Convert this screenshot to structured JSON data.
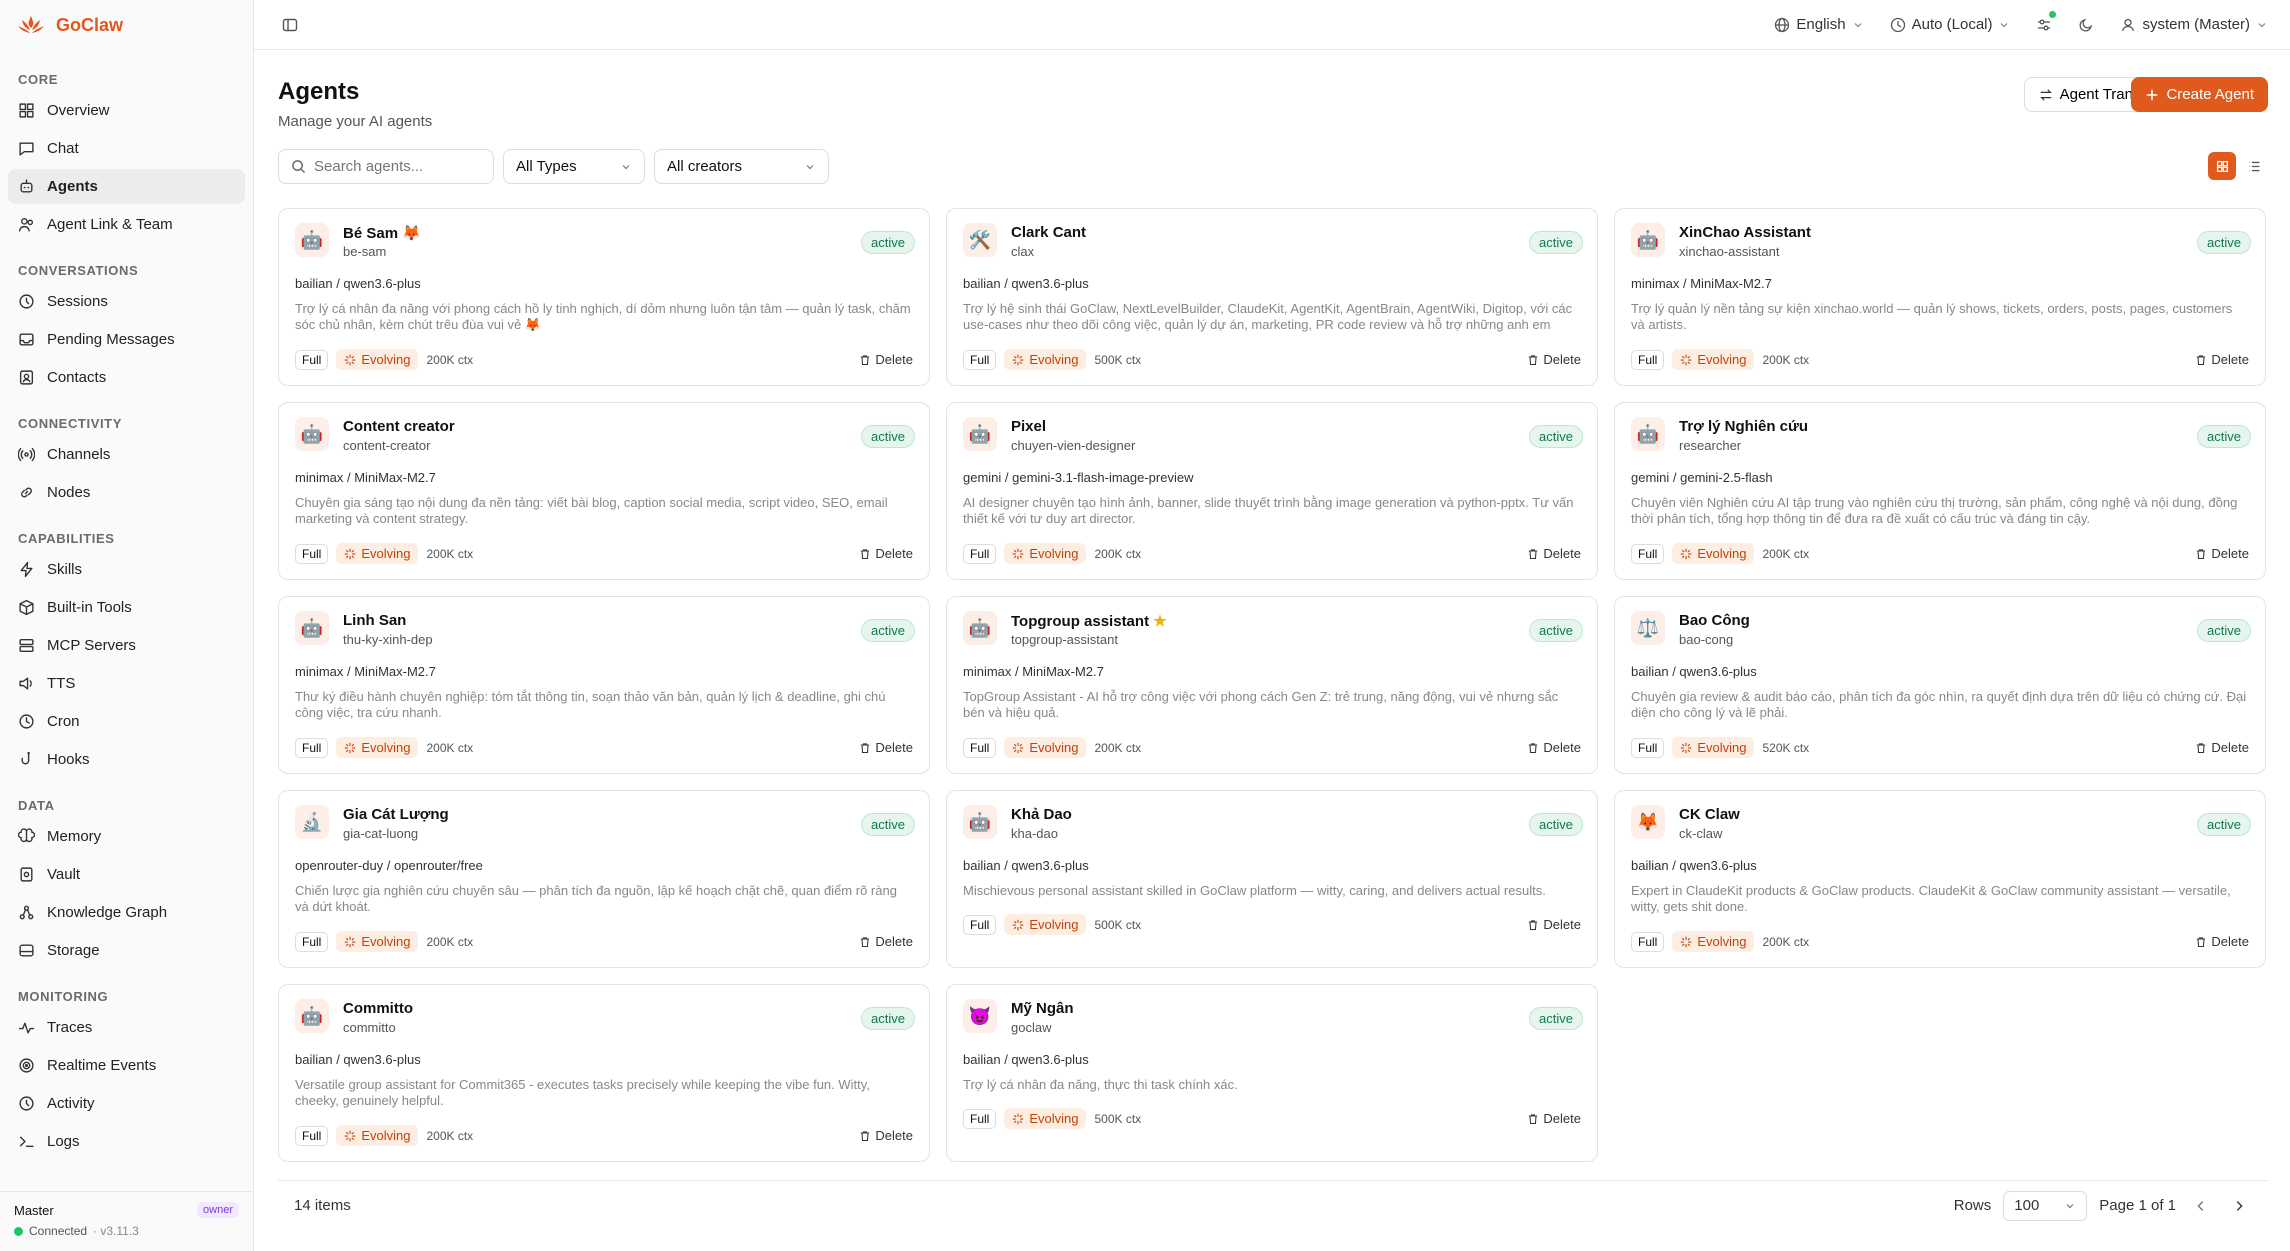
{
  "app": {
    "name": "GoClaw"
  },
  "topbar": {
    "language": "English",
    "timezone": "Auto (Local)",
    "user": "system (Master)"
  },
  "sidebar": {
    "sections": [
      {
        "title": "CORE",
        "items": [
          {
            "label": "Overview",
            "icon": "grid-icon"
          },
          {
            "label": "Chat",
            "icon": "chat-icon"
          },
          {
            "label": "Agents",
            "icon": "bot-icon",
            "active": true
          },
          {
            "label": "Agent Link & Team",
            "icon": "users-icon"
          }
        ]
      },
      {
        "title": "CONVERSATIONS",
        "items": [
          {
            "label": "Sessions",
            "icon": "history-icon"
          },
          {
            "label": "Pending Messages",
            "icon": "inbox-icon"
          },
          {
            "label": "Contacts",
            "icon": "contacts-icon"
          }
        ]
      },
      {
        "title": "CONNECTIVITY",
        "items": [
          {
            "label": "Channels",
            "icon": "radio-icon"
          },
          {
            "label": "Nodes",
            "icon": "link-icon"
          }
        ]
      },
      {
        "title": "CAPABILITIES",
        "items": [
          {
            "label": "Skills",
            "icon": "zap-icon"
          },
          {
            "label": "Built-in Tools",
            "icon": "package-icon"
          },
          {
            "label": "MCP Servers",
            "icon": "server-icon"
          },
          {
            "label": "TTS",
            "icon": "volume-icon"
          },
          {
            "label": "Cron",
            "icon": "clock-icon"
          },
          {
            "label": "Hooks",
            "icon": "hook-icon"
          }
        ]
      },
      {
        "title": "DATA",
        "items": [
          {
            "label": "Memory",
            "icon": "brain-icon"
          },
          {
            "label": "Vault",
            "icon": "vault-icon"
          },
          {
            "label": "Knowledge Graph",
            "icon": "graph-icon"
          },
          {
            "label": "Storage",
            "icon": "storage-icon"
          }
        ]
      },
      {
        "title": "MONITORING",
        "items": [
          {
            "label": "Traces",
            "icon": "activity-icon"
          },
          {
            "label": "Realtime Events",
            "icon": "radar-icon"
          },
          {
            "label": "Activity",
            "icon": "history-icon"
          },
          {
            "label": "Logs",
            "icon": "terminal-icon"
          }
        ]
      }
    ],
    "footer": {
      "user": "Master",
      "role": "owner",
      "status": "Connected",
      "version": "· v3.11.3"
    }
  },
  "page": {
    "title": "Agents",
    "subtitle": "Manage your AI agents",
    "transfer_label": "Agent Transfer",
    "create_label": "Create Agent"
  },
  "filters": {
    "search_placeholder": "Search agents...",
    "types": "All Types",
    "creators": "All creators"
  },
  "agents": [
    {
      "name": "Bé Sam 🦊",
      "key": "be-sam",
      "status": "active",
      "model": "bailian / qwen3.6-plus",
      "desc": "Trợ lý cá nhân đa năng với phong cách hồ ly tinh nghịch, dí dỏm nhưng luôn tận tâm — quản lý task, chăm sóc chủ nhân, kèm chút trêu đùa vui vẻ 🦊",
      "access": "Full",
      "evolving": "Evolving",
      "ctx": "200K ctx",
      "delete": "Delete",
      "avatar": "🤖"
    },
    {
      "name": "Clark Cant",
      "key": "clax",
      "status": "active",
      "model": "bailian / qwen3.6-plus",
      "desc": "Trợ lý hệ sinh thái GoClaw, NextLevelBuilder, ClaudeKit, AgentKit, AgentBrain, AgentWiki, Digitop, với các use-cases như theo dõi công việc, quản lý dự án, marketing, PR code review và hỗ trợ những anh em khác.",
      "access": "Full",
      "evolving": "Evolving",
      "ctx": "500K ctx",
      "delete": "Delete",
      "avatar": "🛠️"
    },
    {
      "name": "XinChao Assistant",
      "key": "xinchao-assistant",
      "status": "active",
      "model": "minimax / MiniMax-M2.7",
      "desc": "Trợ lý quản lý nền tảng sự kiện xinchao.world — quản lý shows, tickets, orders, posts, pages, customers và artists.",
      "access": "Full",
      "evolving": "Evolving",
      "ctx": "200K ctx",
      "delete": "Delete",
      "avatar": "🤖"
    },
    {
      "name": "Content creator",
      "key": "content-creator",
      "status": "active",
      "model": "minimax / MiniMax-M2.7",
      "desc": "Chuyên gia sáng tạo nội dung đa nền tảng: viết bài blog, caption social media, script video, SEO, email marketing và content strategy.",
      "access": "Full",
      "evolving": "Evolving",
      "ctx": "200K ctx",
      "delete": "Delete",
      "avatar": "🤖"
    },
    {
      "name": "Pixel",
      "key": "chuyen-vien-designer",
      "status": "active",
      "model": "gemini / gemini-3.1-flash-image-preview",
      "desc": "AI designer chuyên tạo hình ảnh, banner, slide thuyết trình bằng image generation và python-pptx. Tư vấn thiết kế với tư duy art director.",
      "access": "Full",
      "evolving": "Evolving",
      "ctx": "200K ctx",
      "delete": "Delete",
      "avatar": "🤖"
    },
    {
      "name": "Trợ lý Nghiên cứu",
      "key": "researcher",
      "status": "active",
      "model": "gemini / gemini-2.5-flash",
      "desc": "Chuyên viên Nghiên cứu AI tập trung vào nghiên cứu thị trường, sản phẩm, công nghệ và nội dung, đồng thời phân tích, tổng hợp thông tin để đưa ra đề xuất có cấu trúc và đáng tin cậy.",
      "access": "Full",
      "evolving": "Evolving",
      "ctx": "200K ctx",
      "delete": "Delete",
      "avatar": "🤖"
    },
    {
      "name": "Linh San",
      "key": "thu-ky-xinh-dep",
      "status": "active",
      "model": "minimax / MiniMax-M2.7",
      "desc": "Thư ký điều hành chuyên nghiệp: tóm tắt thông tin, soạn thảo văn bản, quản lý lịch & deadline, ghi chú công việc, tra cứu nhanh.",
      "access": "Full",
      "evolving": "Evolving",
      "ctx": "200K ctx",
      "delete": "Delete",
      "avatar": "🤖"
    },
    {
      "name": "Topgroup assistant",
      "key": "topgroup-assistant",
      "status": "active",
      "model": "minimax / MiniMax-M2.7",
      "desc": "TopGroup Assistant - AI hỗ trợ công việc với phong cách Gen Z: trẻ trung, năng động, vui vẻ nhưng sắc bén và hiệu quả.",
      "access": "Full",
      "evolving": "Evolving",
      "ctx": "200K ctx",
      "delete": "Delete",
      "avatar": "🤖",
      "star": true
    },
    {
      "name": "Bao Công",
      "key": "bao-cong",
      "status": "active",
      "model": "bailian / qwen3.6-plus",
      "desc": "Chuyên gia review & audit báo cáo, phân tích đa góc nhìn, ra quyết định dựa trên dữ liệu có chứng cứ. Đại diện cho công lý và lẽ phải.",
      "access": "Full",
      "evolving": "Evolving",
      "ctx": "520K ctx",
      "delete": "Delete",
      "avatar": "⚖️"
    },
    {
      "name": "Gia Cát Lượng",
      "key": "gia-cat-luong",
      "status": "active",
      "model": "openrouter-duy / openrouter/free",
      "desc": "Chiến lược gia nghiên cứu chuyên sâu — phân tích đa nguồn, lập kế hoạch chặt chẽ, quan điểm rõ ràng và dứt khoát.",
      "access": "Full",
      "evolving": "Evolving",
      "ctx": "200K ctx",
      "delete": "Delete",
      "avatar": "🔬"
    },
    {
      "name": "Khả Dao",
      "key": "kha-dao",
      "status": "active",
      "model": "bailian / qwen3.6-plus",
      "desc": "Mischievous personal assistant skilled in GoClaw platform — witty, caring, and delivers actual results.",
      "access": "Full",
      "evolving": "Evolving",
      "ctx": "500K ctx",
      "delete": "Delete",
      "avatar": "🤖"
    },
    {
      "name": "CK Claw",
      "key": "ck-claw",
      "status": "active",
      "model": "bailian / qwen3.6-plus",
      "desc": "Expert in ClaudeKit products & GoClaw products. ClaudeKit & GoClaw community assistant — versatile, witty, gets shit done.",
      "access": "Full",
      "evolving": "Evolving",
      "ctx": "200K ctx",
      "delete": "Delete",
      "avatar": "🦊"
    },
    {
      "name": "Committo",
      "key": "committo",
      "status": "active",
      "model": "bailian / qwen3.6-plus",
      "desc": "Versatile group assistant for Commit365 - executes tasks precisely while keeping the vibe fun. Witty, cheeky, genuinely helpful.",
      "access": "Full",
      "evolving": "Evolving",
      "ctx": "200K ctx",
      "delete": "Delete",
      "avatar": "🤖"
    },
    {
      "name": "Mỹ Ngân",
      "key": "goclaw",
      "status": "active",
      "model": "bailian / qwen3.6-plus",
      "desc": "Trợ lý cá nhân đa năng, thực thi task chính xác.",
      "access": "Full",
      "evolving": "Evolving",
      "ctx": "500K ctx",
      "delete": "Delete",
      "avatar": "😈"
    }
  ],
  "pagination": {
    "count": "14 items",
    "rows_label": "Rows",
    "rows_value": "100",
    "page_label": "Page 1 of 1"
  },
  "colors": {
    "accent": "#e05a1e",
    "active_green": "#0f7a4c"
  }
}
